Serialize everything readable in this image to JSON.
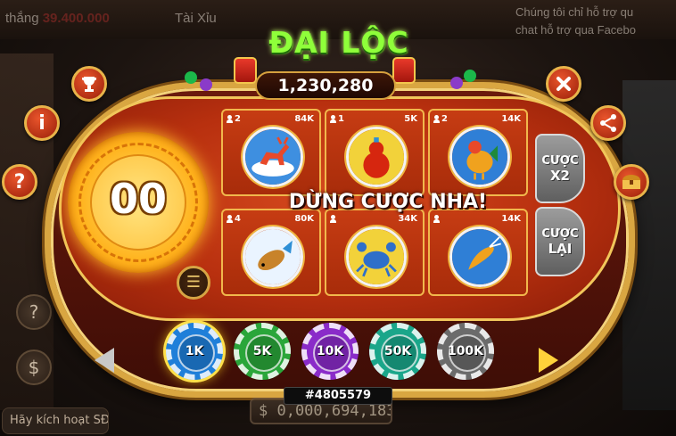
{
  "background": {
    "win_label": "thắng",
    "win_amount": "39.400.000",
    "game_name": "Tài Xỉu",
    "chat_notice": "Chúng tôi chỉ hỗ trợ qu\nchat hỗ trợ qua Facebo",
    "activate_label": "Hãy kích hoạt SĐT",
    "balance": "$ 0,000,694,183"
  },
  "game": {
    "title": "ĐẠI LỘC",
    "jackpot": "1,230,280",
    "timer": "00",
    "status_message": "DỪNG CƯỢC NHA!",
    "session_id": "#4805579"
  },
  "cells": [
    {
      "id": "deer",
      "players": "2",
      "amount": "84K"
    },
    {
      "id": "gourd",
      "players": "1",
      "amount": "5K"
    },
    {
      "id": "rooster",
      "players": "2",
      "amount": "14K"
    },
    {
      "id": "fish",
      "players": "4",
      "amount": "80K"
    },
    {
      "id": "crab",
      "players": "",
      "amount": "34K"
    },
    {
      "id": "shrimp",
      "players": "",
      "amount": "14K"
    }
  ],
  "actions": {
    "double_bet": {
      "line1": "CƯỢC",
      "line2": "X2"
    },
    "rebet": {
      "line1": "CƯỢC",
      "line2": "LẠI"
    }
  },
  "chips": [
    {
      "label": "1K",
      "color": "#1f7fd9",
      "selected": true
    },
    {
      "label": "5K",
      "color": "#2aa63a",
      "selected": false
    },
    {
      "label": "10K",
      "color": "#8a2bc9",
      "selected": false
    },
    {
      "label": "50K",
      "color": "#1aa68a",
      "selected": false
    },
    {
      "label": "100K",
      "color": "#6b6b6b",
      "selected": false
    }
  ],
  "icons": {
    "trophy": "trophy-icon",
    "close": "close-icon",
    "info": "info-icon",
    "help": "question-icon",
    "share": "share-icon",
    "chest": "treasure-chest-icon",
    "history": "history-icon"
  },
  "colors": {
    "frame_gold": "#d9a641",
    "table_red": "#b8300f",
    "title_green": "#8fff3a",
    "timer_plate": "#ffb21c"
  }
}
